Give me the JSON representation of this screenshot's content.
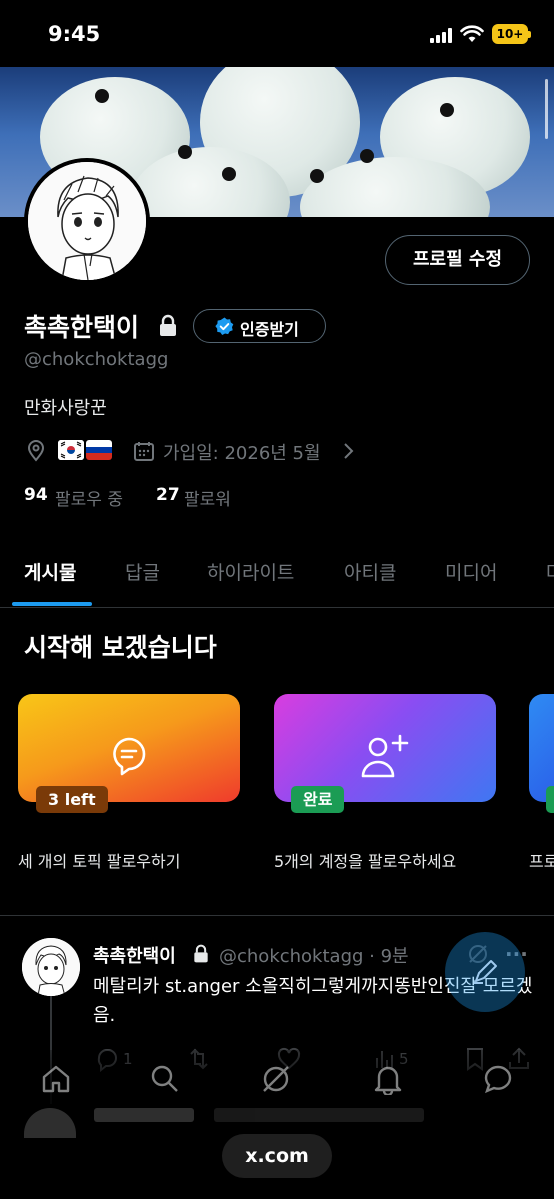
{
  "status_bar": {
    "time": "9:45",
    "battery": "10+"
  },
  "profile": {
    "edit_button": "프로필 수정",
    "display_name": "촉촉한택이",
    "verify_label": "인증받기",
    "handle": "@chokchoktagg",
    "bio": "만화사랑꾼",
    "joined": "가입일: 2026년 5월",
    "following_count": "94",
    "following_label": "팔로우 중",
    "followers_count": "27",
    "followers_label": "팔로워",
    "flags": [
      "KR",
      "RU"
    ]
  },
  "tabs": [
    {
      "label": "게시물",
      "active": true
    },
    {
      "label": "답글"
    },
    {
      "label": "하이라이트"
    },
    {
      "label": "아티클"
    },
    {
      "label": "미디어"
    },
    {
      "label": "마"
    }
  ],
  "getting_started": {
    "title": "시작해 보겠습니다",
    "cards": [
      {
        "badge": "3 left",
        "caption": "세 개의 토픽 팔로우하기",
        "icon": "topic-bubble-icon"
      },
      {
        "badge": "완료",
        "caption": "5개의 계정을 팔로우하세요",
        "icon": "add-person-icon"
      },
      {
        "caption": "프로"
      }
    ]
  },
  "post": {
    "name": "촉촉한택이",
    "meta": "@chokchoktagg · 9분",
    "text": "메탈리카 st.anger 소올직히그렇게까지똥반인진잘 모르겠음.",
    "replies": "1",
    "views": "5"
  },
  "colors": {
    "accent": "#1d9bf0",
    "background": "#000000",
    "muted": "#71767b"
  },
  "url": "x.com"
}
